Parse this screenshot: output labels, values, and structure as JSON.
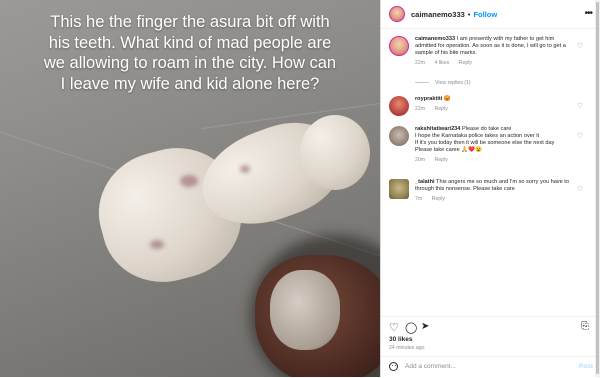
{
  "photo": {
    "caption": "This he the finger the asura bit off with his teeth. What kind of mad people are we allowing to roam in the city. How can I leave my wife and kid alone here?"
  },
  "header": {
    "username": "caimanemo333",
    "dot": "•",
    "follow_label": "Follow",
    "more_icon": "ellipsis-icon"
  },
  "comments": [
    {
      "username": "caimanemo333",
      "text": "I am presently with my father to get him admitted for operation. As soon as it is done, I will go to get a sample of his bite marks.",
      "time": "22m",
      "likes": "4 likes",
      "reply": "Reply",
      "view_replies": "View replies (1)"
    },
    {
      "username": "roypraktiti",
      "text": "😡",
      "time": "22m",
      "reply": "Reply"
    },
    {
      "username": "rakshitatiwari234",
      "text": "Please do take care\nI hope the Karnataka police takes an action over it\nIf it's you today then it will be someone else the next day\nPlease take caree 🙏❤️😮",
      "time": "20m",
      "reply": "Reply"
    },
    {
      "username": "_talathi",
      "text": "This angers me so much and I'm so sorry you have to through this nonsense. Please take care",
      "time": "7m",
      "reply": "Reply"
    }
  ],
  "actions": {
    "likes": "30 likes",
    "posted": "24 minutes ago"
  },
  "add_comment": {
    "placeholder": "Add a comment...",
    "post_label": "Post"
  }
}
